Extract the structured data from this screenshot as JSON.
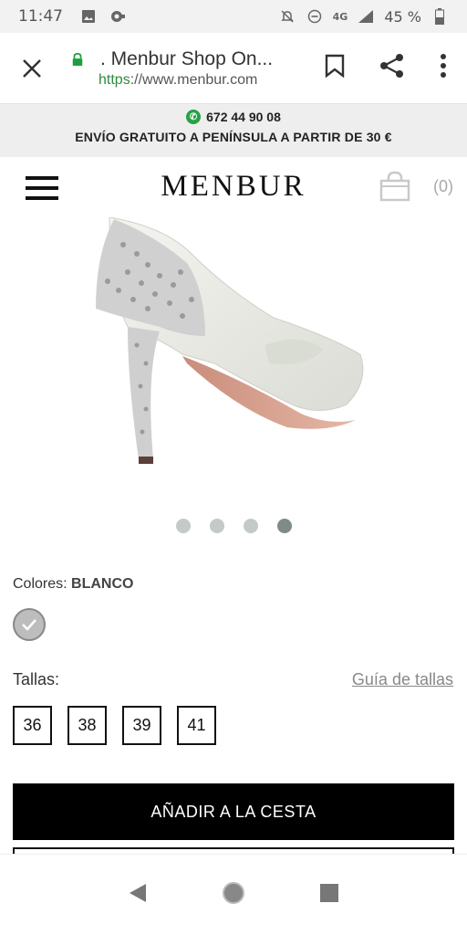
{
  "status_bar": {
    "time": "11:47",
    "network": "4G",
    "battery": "45 %"
  },
  "browser": {
    "page_title": ". Menbur Shop On...",
    "url_scheme": "https",
    "url_rest": "://www.menbur.com"
  },
  "promo": {
    "phone": "672 44 90 08",
    "shipping": "ENVÍO GRATUITO A PENÍNSULA A PARTIR DE 30 €"
  },
  "shop": {
    "logo": "MENBUR",
    "cart_count": "(0)"
  },
  "carousel": {
    "slide_count": 4,
    "active_index": 3
  },
  "product": {
    "colors_label": "Colores:",
    "color_value": "BLANCO",
    "sizes_label": "Tallas:",
    "size_guide": "Guía de tallas",
    "sizes": [
      "36",
      "38",
      "39",
      "41"
    ],
    "add_to_cart": "AÑADIR A LA CESTA"
  },
  "colors": {
    "accent": "#000000",
    "https_green": "#2e8b3d",
    "promo_bg": "#eeeeee"
  }
}
